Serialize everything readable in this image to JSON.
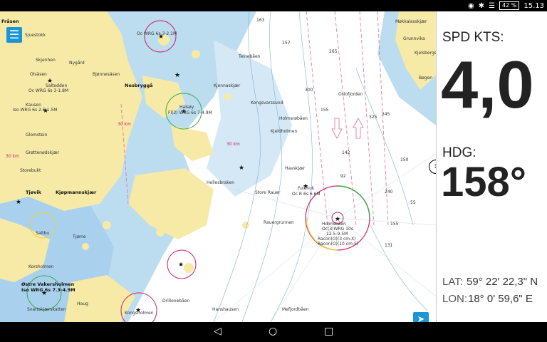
{
  "status_bar": {
    "battery": "42 %",
    "time": "15.13"
  },
  "icons": {
    "location": "location-pin-icon",
    "bluetooth": "bluetooth-icon",
    "wifi": "wifi-icon",
    "menu": "hamburger-menu-icon",
    "locate": "navigation-arrow-icon",
    "collapse": "chevron-right-icon"
  },
  "panel": {
    "speed_label": "SPD KTS:",
    "speed_value": "4,0",
    "heading_label": "HDG:",
    "heading_value": "158°",
    "lat_label": "LAT:",
    "lat_value": "59° 22' 22,3\" N",
    "lon_label": "LON:",
    "lon_value": "18° 0' 59,6\" E"
  },
  "map_labels": [
    "Fråsen",
    "Sjuestokk",
    "Skjenhen",
    "Nygård",
    "Olsäsen",
    "Bjønnesäsen",
    "Saltodden",
    "Oc WRG 6s 3-1.8M",
    "Kausen",
    "Iso WRG 6s 2.6-1.5M",
    "Glomstein",
    "Grøttenødskjær",
    "Storebukt",
    "Tjøvik",
    "Kjøpmannskjær",
    "Saltbu",
    "Tjøme",
    "Korsholmen",
    "Østre Vakersholmen",
    "Iso WRG 6s 7.3-4.9M",
    "Svartskjærskatten",
    "Haug",
    "Nesbryggå",
    "Kjennaskjær",
    "Halsøy",
    "Fl(2) WRG 6s 7-4.9M",
    "Oc WRG 6s 3-2.1M",
    "Telnebåen",
    "Oslofjorden",
    "Kongsvarssund",
    "Holmsrøbåen",
    "Kjeldholmen",
    "Havskjær",
    "Fulehuk",
    "Oc R 6s 6.6M",
    "Hellesbraken",
    "Store Rauer",
    "Rauergrunnen",
    "Holmsbåen",
    "Oc(3)WRG 10s",
    "12.5-9.5M",
    "Racon(O)(3 cm-X)",
    "Racon(O)(10 cm-S)",
    "Kongsholmen",
    "Drilleneb&#229;en",
    "Hanshausen",
    "Mefjordbåen",
    "Møkkalasskjær",
    "Grunnvika",
    "Kjelsbergskjær",
    "Bøgen"
  ]
}
